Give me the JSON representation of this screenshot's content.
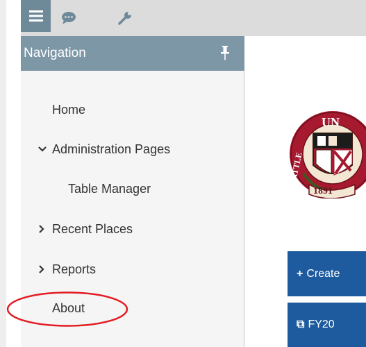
{
  "toolbar": {
    "menu_icon": "hamburger-menu-icon",
    "chat_icon": "chat-bubble-icon",
    "tools_icon": "wrench-icon"
  },
  "sidebar": {
    "title": "Navigation",
    "pin_icon": "pushpin-icon",
    "items": [
      {
        "label": "Home"
      },
      {
        "label": "Administration Pages",
        "expanded": true
      },
      {
        "label": "Table Manager"
      },
      {
        "label": "Recent Places",
        "expanded": false
      },
      {
        "label": "Reports",
        "expanded": false
      },
      {
        "label": "About"
      }
    ]
  },
  "main": {
    "logo": {
      "letters_top": "UN",
      "letters_side": "SEATTLE",
      "year": "1891"
    },
    "buttons": [
      {
        "icon": "plus-icon",
        "icon_glyph": "+",
        "label": "Create"
      },
      {
        "icon": "external-link-icon",
        "icon_glyph": "⧉",
        "label": "FY20"
      }
    ]
  },
  "colors": {
    "nav_header": "#7e97a7",
    "menu_button": "#6e8998",
    "primary_button": "#1e5b9e",
    "annotation": "#e31b23",
    "seal_red": "#a6192e"
  }
}
